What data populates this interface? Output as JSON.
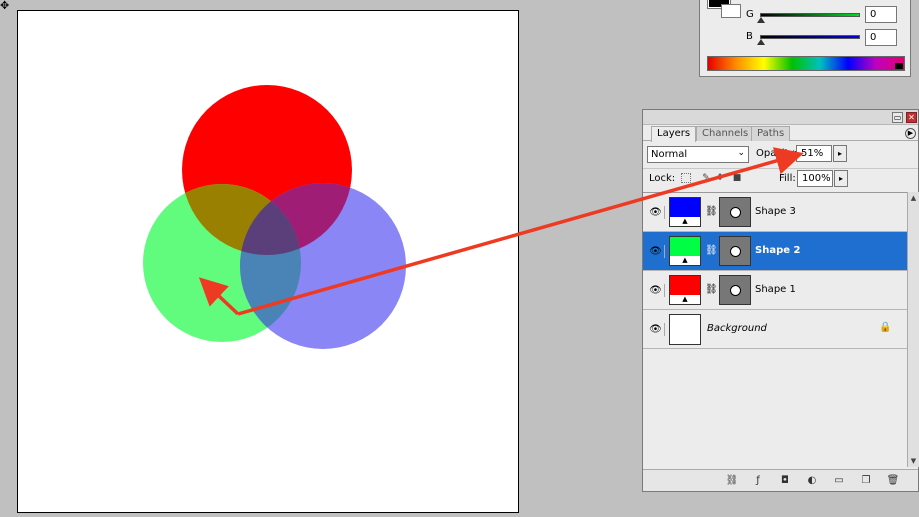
{
  "color_panel": {
    "channels": [
      {
        "label": "G",
        "value": "0",
        "color": "#00b020"
      },
      {
        "label": "B",
        "value": "0",
        "color": "#0000dd"
      }
    ]
  },
  "layers_panel": {
    "tabs": [
      "Layers",
      "Channels",
      "Paths"
    ],
    "blend_mode": "Normal",
    "opacity_label": "Opacity:",
    "opacity_value": "51%",
    "lock_label": "Lock:",
    "fill_label": "Fill:",
    "fill_value": "100%",
    "layers": [
      {
        "name": "Shape 3",
        "color": "#0000ff",
        "selected": false
      },
      {
        "name": "Shape 2",
        "color": "#00ff44",
        "selected": true
      },
      {
        "name": "Shape 1",
        "color": "#ff0000",
        "selected": false
      }
    ],
    "background_name": "Background"
  },
  "canvas": {
    "colors": {
      "red": "#ff0000",
      "green": "#61fc7d",
      "blue": "#8a86f5",
      "overlap_red_green": "#9a8000",
      "overlap_red_blue": "#a01d75",
      "overlap_green_blue": "#4a83b5"
    }
  },
  "annotation": {
    "arrow_color": "#ee3a22"
  }
}
